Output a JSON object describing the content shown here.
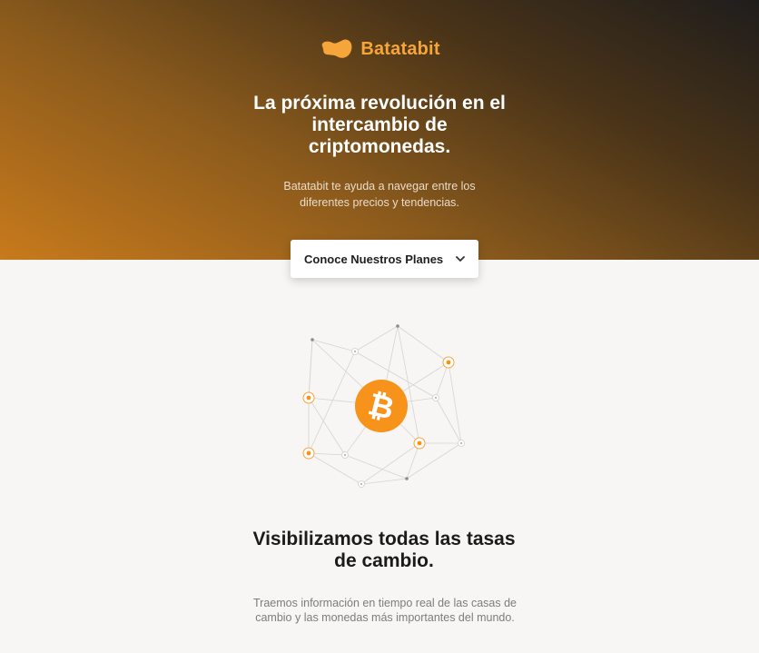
{
  "brand": {
    "name": "Batatabit",
    "logo_icon": "potato-logo-icon",
    "accent_color": "#f6a53b"
  },
  "hero": {
    "title": "La próxima revolución en el intercambio de criptomonedas.",
    "subtitle": "Batatabit te ayuda a navegar entre los diferentes precios y tendencias.",
    "cta_label": "Conoce Nuestros Planes",
    "cta_icon": "chevron-down-icon"
  },
  "illustration": {
    "center_icon": "bitcoin-icon",
    "center_color": "#f7931a"
  },
  "section": {
    "title": "Visibilizamos todas las tasas de cambio.",
    "text": "Traemos información en tiempo real de las casas de cambio y las monedas más importantes del mundo."
  }
}
